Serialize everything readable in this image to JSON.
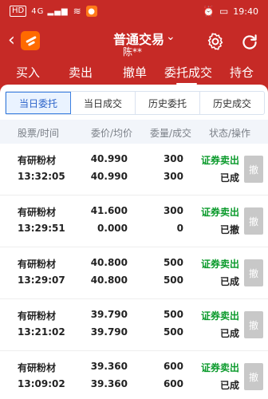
{
  "status_bar": {
    "hd_label": "HD",
    "signal": "4G ▂▄▆",
    "time": "19:40",
    "icons": [
      "wifi-icon",
      "alarm-icon",
      "battery-icon"
    ]
  },
  "header": {
    "title": "普通交易",
    "account": "陈**",
    "dropdown_icon": "chevron-down-icon"
  },
  "tabs": [
    "买入",
    "卖出",
    "撤单",
    "委托成交",
    "持仓"
  ],
  "subtabs": [
    "当日委托",
    "当日成交",
    "历史委托",
    "历史成交"
  ],
  "columns": {
    "stock": "股票/时间",
    "price": "委价/均价",
    "qty": "委量/成交",
    "status": "状态/操作"
  },
  "rows": [
    {
      "name": "有研粉材",
      "time": "13:32:05",
      "price": "40.990",
      "avg": "40.990",
      "qty": "300",
      "filled": "300",
      "action": "证券卖出",
      "status": "已成",
      "btn": "撤"
    },
    {
      "name": "有研粉材",
      "time": "13:29:51",
      "price": "41.600",
      "avg": "0.000",
      "qty": "300",
      "filled": "0",
      "action": "证券卖出",
      "status": "已撤",
      "btn": "撤"
    },
    {
      "name": "有研粉材",
      "time": "13:29:07",
      "price": "40.800",
      "avg": "40.800",
      "qty": "500",
      "filled": "500",
      "action": "证券卖出",
      "status": "已成",
      "btn": "撤"
    },
    {
      "name": "有研粉材",
      "time": "13:21:02",
      "price": "39.790",
      "avg": "39.790",
      "qty": "500",
      "filled": "500",
      "action": "证券卖出",
      "status": "已成",
      "btn": "撤"
    },
    {
      "name": "有研粉材",
      "time": "13:09:02",
      "price": "39.360",
      "avg": "39.360",
      "qty": "600",
      "filled": "600",
      "action": "证券卖出",
      "status": "已成",
      "btn": "撤"
    }
  ]
}
